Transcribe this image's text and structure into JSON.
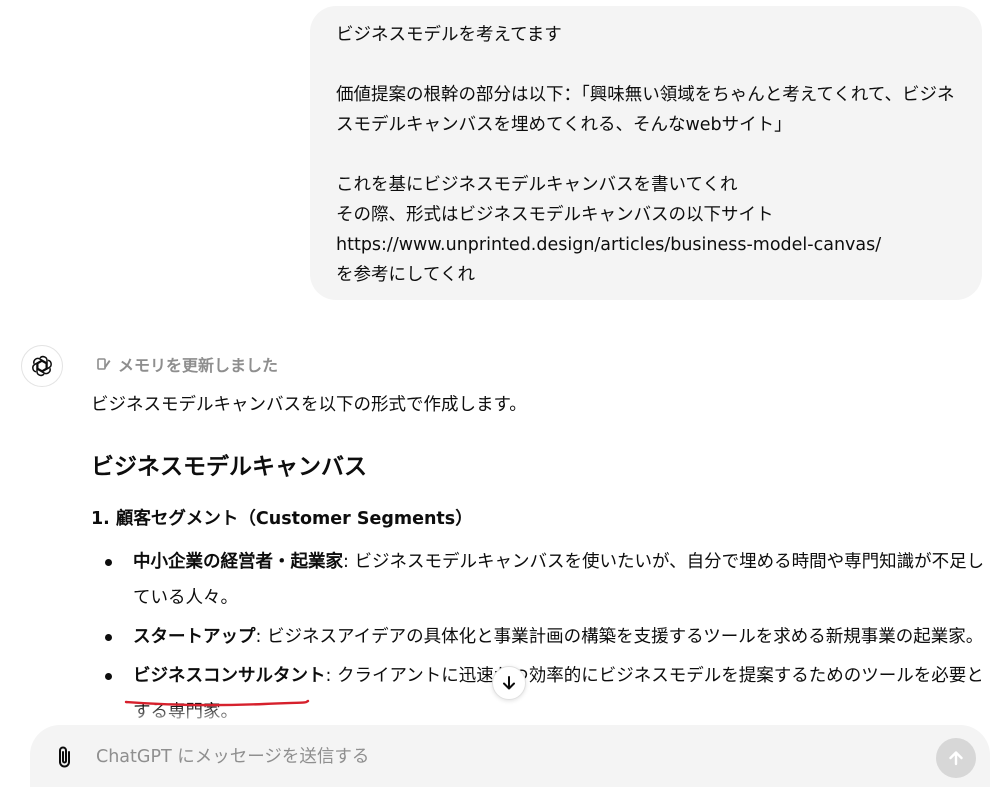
{
  "user_message": {
    "lines": [
      "ビジネスモデルを考えてます",
      "",
      "価値提案の根幹の部分は以下：「興味無い領域をちゃんと考えてくれて、ビジネスモデルキャンバスを埋めてくれる、そんなwebサイト」",
      "",
      "これを基にビジネスモデルキャンバスを書いてくれ",
      "その際、形式はビジネスモデルキャンバスの以下サイト",
      "https://www.unprinted.design/articles/business-model-canvas/",
      "を参考にしてくれ"
    ]
  },
  "assistant": {
    "memory_note": "メモリを更新しました",
    "intro": "ビジネスモデルキャンバスを以下の形式で作成します。",
    "heading": "ビジネスモデルキャンバス",
    "section_title": "1. 顧客セグメント（Customer Segments）",
    "bullets": [
      {
        "term": "中小企業の経営者・起業家",
        "text": ": ビジネスモデルキャンバスを使いたいが、自分で埋める時間や専門知識が不足している人々。"
      },
      {
        "term": "スタートアップ",
        "text": ": ビジネスアイデアの具体化と事業計画の構築を支援するツールを求める新規事業の起業家。"
      },
      {
        "term": "ビジネスコンサルタント",
        "text": ": クライアントに迅速かつ効率的にビジネスモデルを提案するためのツールを必要とする専門家。"
      }
    ]
  },
  "composer": {
    "placeholder": "ChatGPT にメッセージを送信する"
  },
  "icons": {
    "avatar": "openai-logo-icon",
    "memory": "memory-pen-icon",
    "scroll": "arrow-down-icon",
    "attach": "paperclip-icon",
    "send": "arrow-up-icon"
  },
  "colors": {
    "bubble": "#f4f4f4",
    "annotation_underline": "#d6202c",
    "send_disabled": "#d7d7d7"
  }
}
